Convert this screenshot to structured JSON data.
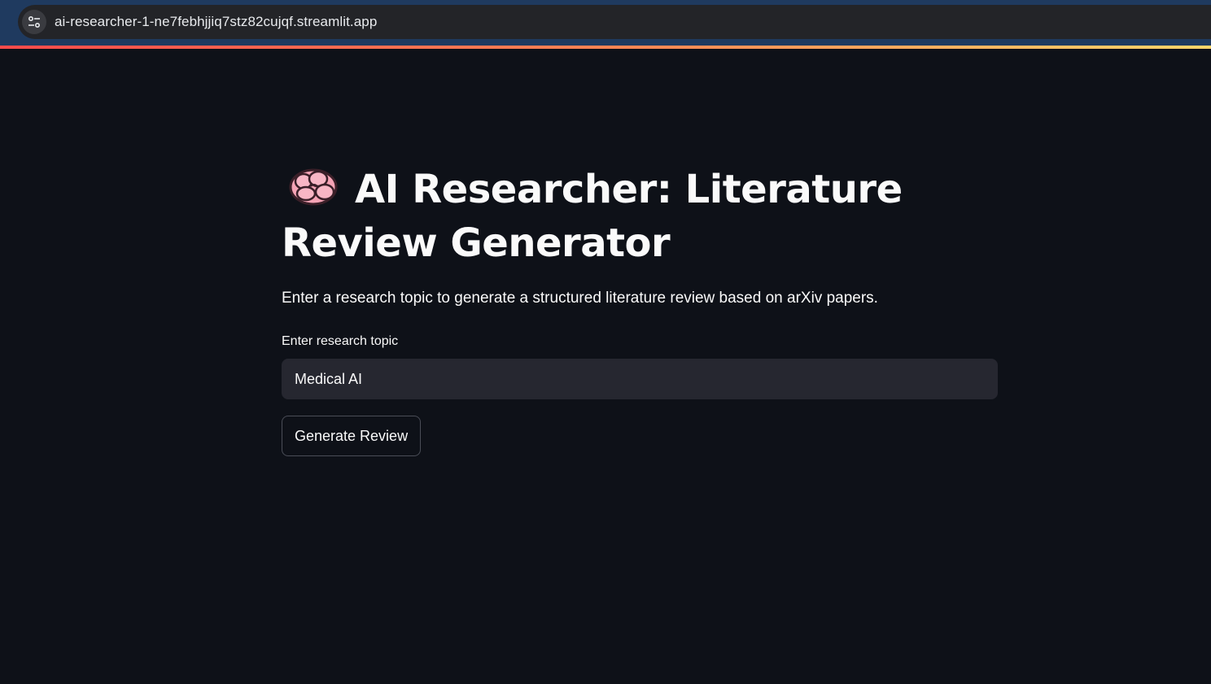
{
  "browser": {
    "url": "ai-researcher-1-ne7febhjjiq7stz82cujqf.streamlit.app",
    "site_info_icon": "tune-icon"
  },
  "header": {
    "decoration_colors": [
      "#ff4b4b",
      "#ff8a55",
      "#ffd56a"
    ]
  },
  "main": {
    "title_icon": "brain-icon",
    "title": "AI Researcher: Literature Review Generator",
    "description": "Enter a research topic to generate a structured literature review based on arXiv papers.",
    "topic_input": {
      "label": "Enter research topic",
      "value": "Medical AI"
    },
    "generate_button_label": "Generate Review"
  },
  "theme": {
    "background": "#0e1118",
    "input_background": "#262730",
    "text": "#fafafa"
  }
}
